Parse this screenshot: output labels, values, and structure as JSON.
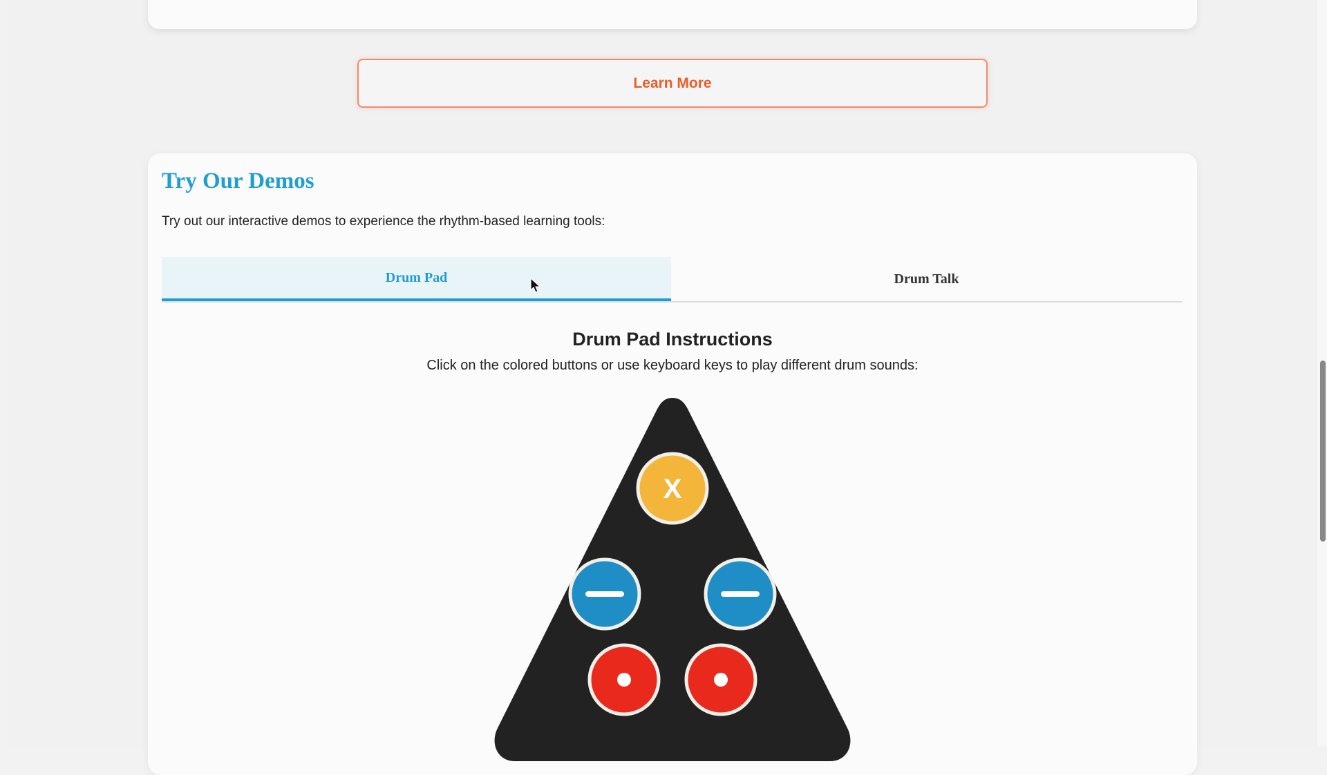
{
  "learn_more": {
    "label": "Learn More",
    "accent_color": "#ef5b25"
  },
  "demos": {
    "title": "Try Our Demos",
    "description": "Try out our interactive demos to experience the rhythm-based learning tools:",
    "accent_color": "#1f9ed1",
    "tabs": [
      {
        "label": "Drum Pad",
        "active": true
      },
      {
        "label": "Drum Talk",
        "active": false
      }
    ],
    "instructions": {
      "title": "Drum Pad Instructions",
      "text": "Click on the colored buttons or use keyboard keys to play different drum sounds:"
    },
    "drum_pad": {
      "pad_color": "#222222",
      "keys": [
        {
          "name": "top-key",
          "label": "X",
          "color": "#f4b63a",
          "symbol": "letter"
        },
        {
          "name": "middle-left-key",
          "color": "#1f8ec6",
          "symbol": "minus-icon"
        },
        {
          "name": "middle-right-key",
          "color": "#1f8ec6",
          "symbol": "minus-icon"
        },
        {
          "name": "bottom-left-key",
          "color": "#e8291c",
          "symbol": "dot-icon"
        },
        {
          "name": "bottom-right-key",
          "color": "#e8291c",
          "symbol": "dot-icon"
        }
      ]
    }
  }
}
